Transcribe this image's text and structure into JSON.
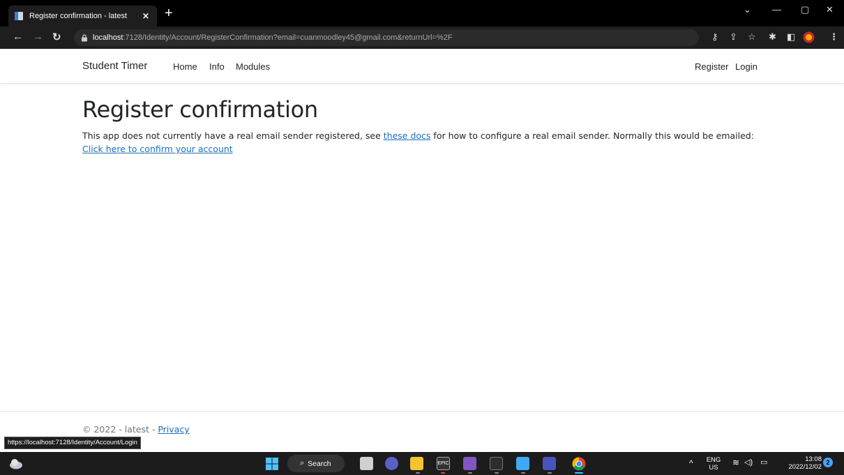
{
  "browser": {
    "tab_title": "Register confirmation - latest",
    "tab_close": "×",
    "new_tab": "+",
    "url_host": "localhost",
    "url_rest": ":7128/Identity/Account/RegisterConfirmation?email=cuanmoodley45@gmail.com&returnUrl=%2F",
    "status_url": "https://localhost:7128/Identity/Account/Login"
  },
  "navbar": {
    "brand": "Student Timer",
    "left_links": [
      "Home",
      "Info",
      "Modules"
    ],
    "right_links": [
      "Register",
      "Login"
    ]
  },
  "main": {
    "title": "Register confirmation",
    "text_before": "This app does not currently have a real email sender registered, see ",
    "docs_link": "these docs",
    "text_middle": " for how to configure a real email sender. Normally this would be emailed: ",
    "confirm_link": "Click here to confirm your account"
  },
  "footer": {
    "copyright": "© 2022 - latest - ",
    "privacy_link": "Privacy"
  },
  "taskbar": {
    "search_label": "Search",
    "lang_top": "ENG",
    "lang_bottom": "US",
    "time": "13:08",
    "date": "2022/12/02",
    "notifications": "2"
  },
  "colors": {
    "link": "#1b6ec2",
    "browser_dark": "#1e1e1e"
  }
}
